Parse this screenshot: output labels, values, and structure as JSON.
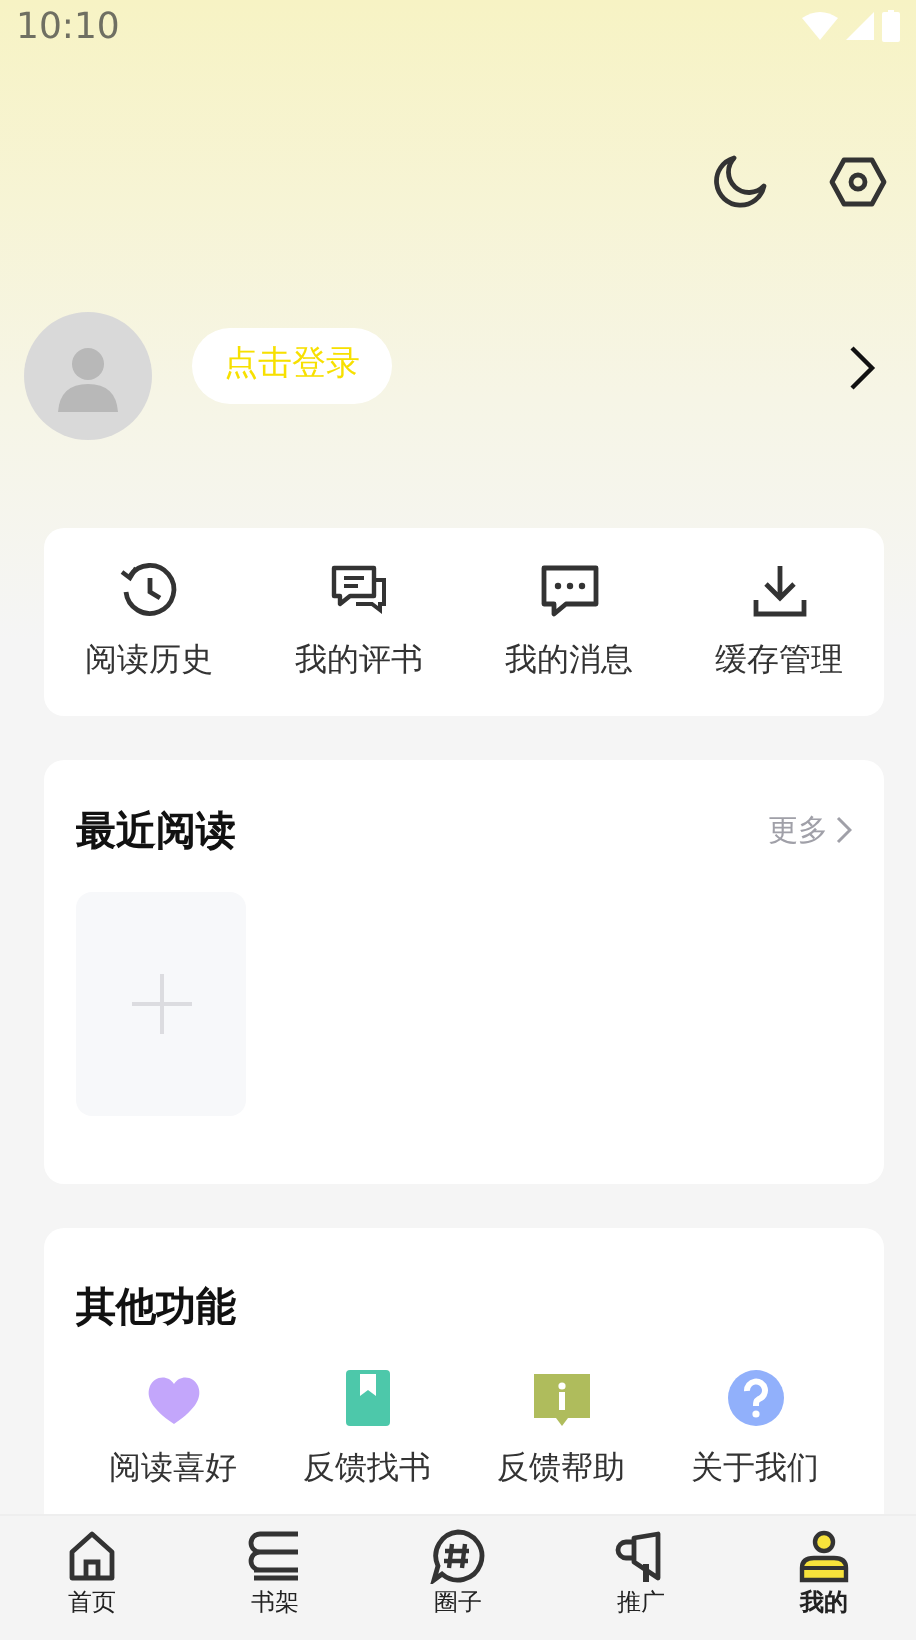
{
  "status_bar": {
    "time": "10:10"
  },
  "profile": {
    "login_label": "点击登录"
  },
  "quick_actions": [
    {
      "label": "阅读历史"
    },
    {
      "label": "我的评书"
    },
    {
      "label": "我的消息"
    },
    {
      "label": "缓存管理"
    }
  ],
  "recent_reading": {
    "title": "最近阅读",
    "more": "更多"
  },
  "other_functions": {
    "title": "其他功能",
    "items": [
      {
        "label": "阅读喜好",
        "color": "#c3a6fb"
      },
      {
        "label": "反馈找书",
        "color": "#4dc8aa"
      },
      {
        "label": "反馈帮助",
        "color": "#afbc5c"
      },
      {
        "label": "关于我们",
        "color": "#91b0fb"
      }
    ]
  },
  "tab_bar": [
    {
      "label": "首页",
      "selected": false
    },
    {
      "label": "书架",
      "selected": false
    },
    {
      "label": "圈子",
      "selected": false
    },
    {
      "label": "推广",
      "selected": false
    },
    {
      "label": "我的",
      "selected": true
    }
  ]
}
